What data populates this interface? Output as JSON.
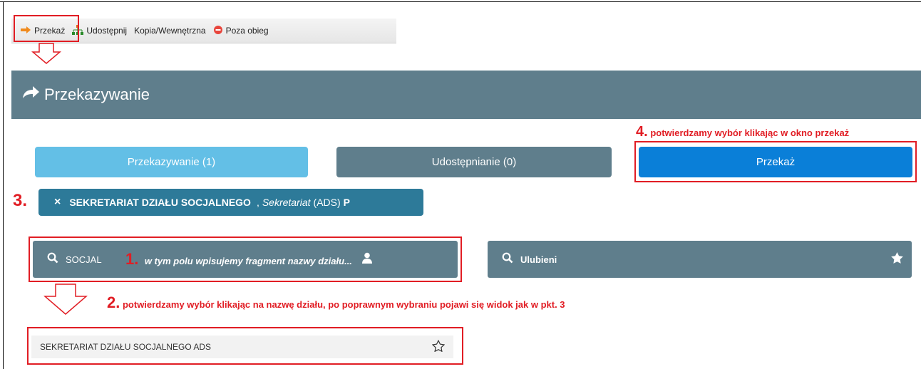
{
  "toolbar": {
    "items": [
      {
        "label": "Przekaż",
        "icon": "arrow-right-icon"
      },
      {
        "label": "Udostępnij",
        "icon": "share-tree-icon"
      },
      {
        "label": "Kopia/Wewnętrzna",
        "icon": ""
      },
      {
        "label": "Poza obieg",
        "icon": "stop-circle-icon"
      }
    ]
  },
  "header": {
    "title": "Przekazywanie",
    "icon": "forward-arrow-icon"
  },
  "tabs": {
    "przekazywanie": "Przekazywanie (1)",
    "udostepnianie": "Udostępnianie (0)",
    "przekaz_button": "Przekaż"
  },
  "chip": {
    "close": "×",
    "name": "SEKRETARIAT DZIAŁU SOCJALNEGO",
    "comma": ",",
    "role": "Sekretariat",
    "code": "(ADS)",
    "flag": "P"
  },
  "search": {
    "value": "SOCJAL",
    "favorites_label": "Ulubieni"
  },
  "result": {
    "label": "SEKRETARIAT DZIAŁU SOCJALNEGO ADS"
  },
  "annotations": {
    "n1": "1.",
    "t1": "w tym polu wpisujemy fragment nazwy działu...",
    "n2": "2.",
    "t2": "potwierdzamy wybór klikając na nazwę działu, po poprawnym wybraniu pojawi się widok jak w pkt. 3",
    "n3": "3.",
    "n4": "4.",
    "t4": "potwierdzamy wybór klikając w okno przekaż"
  },
  "colors": {
    "header": "#5f7e8c",
    "tab_active": "#63bfe6",
    "tab_inactive": "#5f7e8c",
    "primary": "#0a7fd8",
    "chip": "#2d7a99",
    "annotation": "#e11d24"
  }
}
